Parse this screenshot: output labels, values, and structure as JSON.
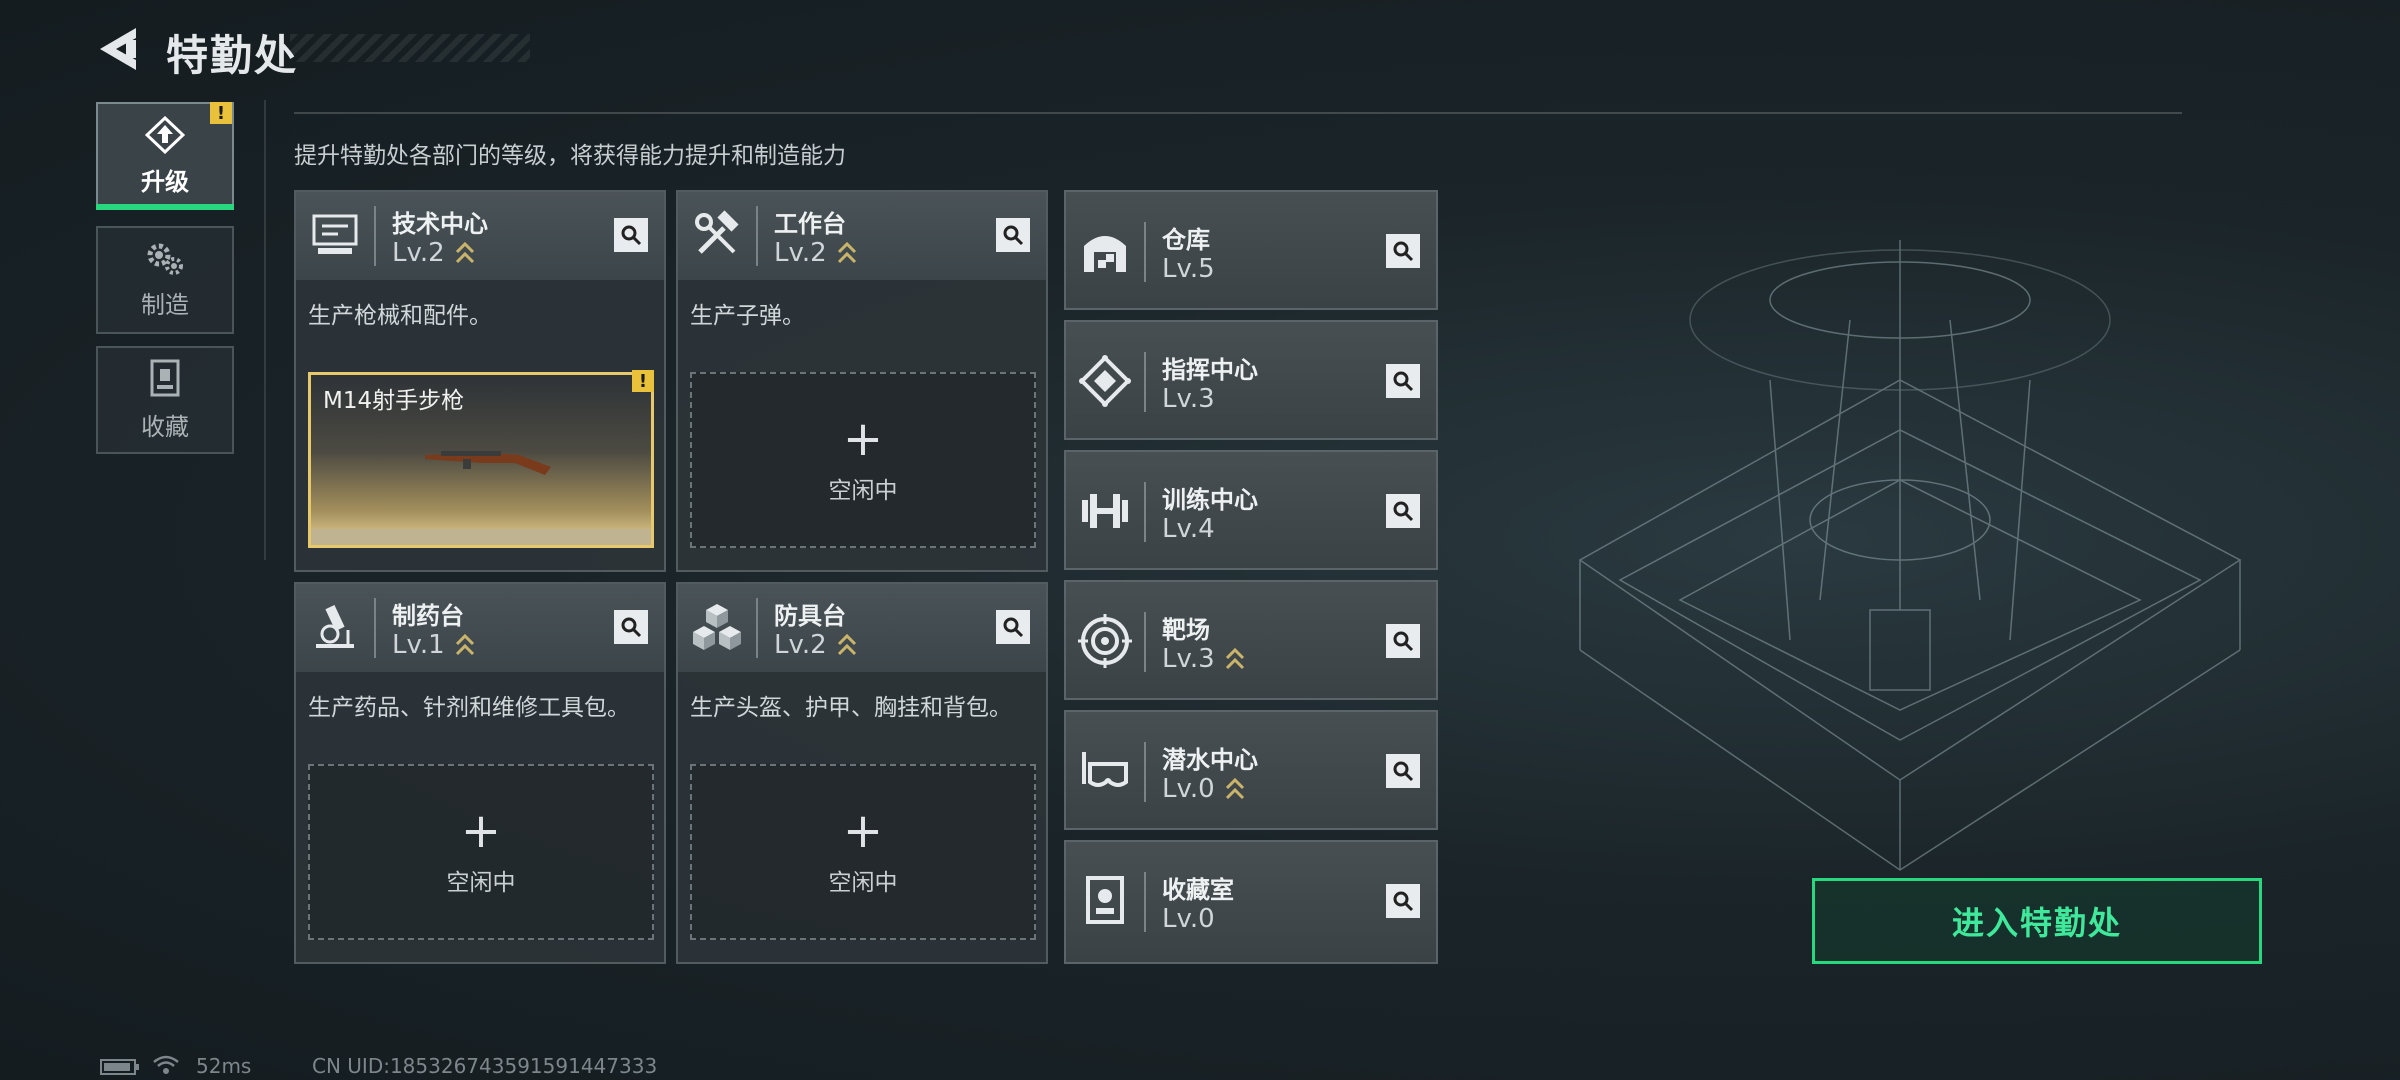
{
  "header": {
    "title": "特勤处"
  },
  "nav": {
    "tabs": [
      {
        "label": "升级",
        "icon": "upgrade-icon",
        "active": true,
        "alert": "!"
      },
      {
        "label": "制造",
        "icon": "gears-icon",
        "active": false
      },
      {
        "label": "收藏",
        "icon": "collection-icon",
        "active": false
      }
    ]
  },
  "main": {
    "subtitle": "提升特勤处各部门的等级，将获得能力提升和制造能力",
    "departments": [
      {
        "name": "技术中心",
        "level": "Lv.2",
        "icon": "monitor-icon",
        "desc": "生产枪械和配件。",
        "slot": {
          "type": "item",
          "name": "M14射手步枪",
          "alert": "!"
        }
      },
      {
        "name": "工作台",
        "level": "Lv.2",
        "icon": "tools-icon",
        "desc": "生产子弹。",
        "slot": {
          "type": "empty",
          "label": "空闲中"
        }
      },
      {
        "name": "制药台",
        "level": "Lv.1",
        "icon": "microscope-icon",
        "desc": "生产药品、针剂和维修工具包。",
        "slot": {
          "type": "empty",
          "label": "空闲中"
        }
      },
      {
        "name": "防具台",
        "level": "Lv.2",
        "icon": "cubes-icon",
        "desc": "生产头盔、护甲、胸挂和背包。",
        "slot": {
          "type": "empty",
          "label": "空闲中"
        }
      }
    ],
    "facilities": [
      {
        "name": "仓库",
        "level": "Lv.5",
        "icon": "warehouse-icon",
        "upgradable": false
      },
      {
        "name": "指挥中心",
        "level": "Lv.3",
        "icon": "command-icon",
        "upgradable": false
      },
      {
        "name": "训练中心",
        "level": "Lv.4",
        "icon": "dumbbell-icon",
        "upgradable": false
      },
      {
        "name": "靶场",
        "level": "Lv.3",
        "icon": "target-icon",
        "upgradable": true
      },
      {
        "name": "潜水中心",
        "level": "Lv.0",
        "icon": "diving-mask-icon",
        "upgradable": true
      },
      {
        "name": "收藏室",
        "level": "Lv.0",
        "icon": "trophy-case-icon",
        "upgradable": false
      }
    ],
    "plus_symbol": "+"
  },
  "enter_button": {
    "label": "进入特勤处"
  },
  "status": {
    "ping": "52ms",
    "uid": "CN UID:185326743591591447333"
  },
  "colors": {
    "accent_green": "#27d87e",
    "alert_yellow": "#e9c13a",
    "upgrade_arrow": "#c9b46a"
  }
}
